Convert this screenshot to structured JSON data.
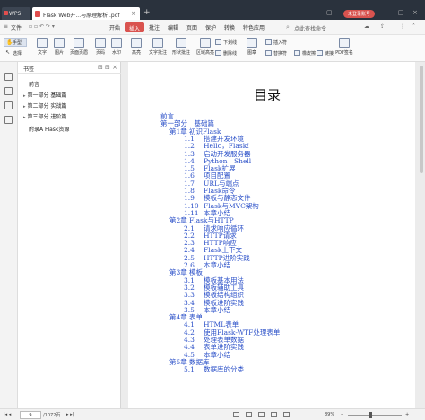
{
  "titlebar": {
    "app_tab": "WPS",
    "doc_tab": "Flask Web开...与原理解析 .pdf",
    "login": "未登录账号"
  },
  "menubar": {
    "items": [
      "文件",
      "开始",
      "插入",
      "批注",
      "编辑",
      "页面",
      "保护",
      "转换",
      "特色应用"
    ],
    "active": "插入",
    "search": "点此查找命令"
  },
  "toolbar": {
    "hand": "手型",
    "select": "选择",
    "buttons": [
      "文字",
      "图片",
      "页面页眉",
      "页码",
      "水印",
      "高亮",
      "文字批注",
      "形状批注",
      "区域高亮",
      "图章",
      "PDF签名"
    ],
    "small": [
      "下划线",
      "删除线",
      "插入符",
      "替换符",
      "橡皮擦",
      "链接"
    ]
  },
  "bookmarks": {
    "header": "书签",
    "items": [
      "前言",
      "第一部分 基础篇",
      "第二部分 实战篇",
      "第三部分 进阶篇",
      "附录A Flask资源"
    ]
  },
  "document": {
    "title": "目录",
    "lines": [
      {
        "num": "",
        "text": "前言",
        "indent": 0
      },
      {
        "num": "",
        "text": "第一部分　基础篇",
        "indent": 0
      },
      {
        "num": "第1章",
        "text": "初识Flask",
        "indent": 1
      },
      {
        "num": "1.1",
        "text": "搭建开发环境",
        "indent": 2
      },
      {
        "num": "1.2",
        "text": "Hello，Flask!",
        "indent": 2
      },
      {
        "num": "1.3",
        "text": "启动开发服务器",
        "indent": 2
      },
      {
        "num": "1.4",
        "text": "Python　Shell",
        "indent": 2
      },
      {
        "num": "1.5",
        "text": "Flask扩展",
        "indent": 2
      },
      {
        "num": "1.6",
        "text": "项目配置",
        "indent": 2
      },
      {
        "num": "1.7",
        "text": "URL与端点",
        "indent": 2
      },
      {
        "num": "1.8",
        "text": "Flask命令",
        "indent": 2
      },
      {
        "num": "1.9",
        "text": "模板与静态文件",
        "indent": 2
      },
      {
        "num": "1.10",
        "text": "Flask与MVC架构",
        "indent": 2
      },
      {
        "num": "1.11",
        "text": "本章小结",
        "indent": 2
      },
      {
        "num": "第2章",
        "text": "Flask与HTTP",
        "indent": 1
      },
      {
        "num": "2.1",
        "text": "请求响应循环",
        "indent": 2
      },
      {
        "num": "2.2",
        "text": "HTTP请求",
        "indent": 2
      },
      {
        "num": "2.3",
        "text": "HTTP响应",
        "indent": 2
      },
      {
        "num": "2.4",
        "text": "Flask上下文",
        "indent": 2
      },
      {
        "num": "2.5",
        "text": "HTTP进阶实践",
        "indent": 2
      },
      {
        "num": "2.6",
        "text": "本章小结",
        "indent": 2
      },
      {
        "num": "第3章",
        "text": "模板",
        "indent": 1
      },
      {
        "num": "3.1",
        "text": "模板基本用法",
        "indent": 2
      },
      {
        "num": "3.2",
        "text": "模板辅助工具",
        "indent": 2
      },
      {
        "num": "3.3",
        "text": "模板结构组织",
        "indent": 2
      },
      {
        "num": "3.4",
        "text": "模板进阶实践",
        "indent": 2
      },
      {
        "num": "3.5",
        "text": "本章小结",
        "indent": 2
      },
      {
        "num": "第4章",
        "text": "表单",
        "indent": 1
      },
      {
        "num": "4.1",
        "text": "HTML表单",
        "indent": 2
      },
      {
        "num": "4.2",
        "text": "使用Flask-WTF处理表单",
        "indent": 2
      },
      {
        "num": "4.3",
        "text": "处理表单数据",
        "indent": 2
      },
      {
        "num": "4.4",
        "text": "表单进阶实践",
        "indent": 2
      },
      {
        "num": "4.5",
        "text": "本章小结",
        "indent": 2
      },
      {
        "num": "第5章",
        "text": "数据库",
        "indent": 1
      },
      {
        "num": "5.1",
        "text": "数据库的分类",
        "indent": 2
      }
    ]
  },
  "statusbar": {
    "page": "9",
    "total": "/1072页",
    "zoom": "89%"
  }
}
